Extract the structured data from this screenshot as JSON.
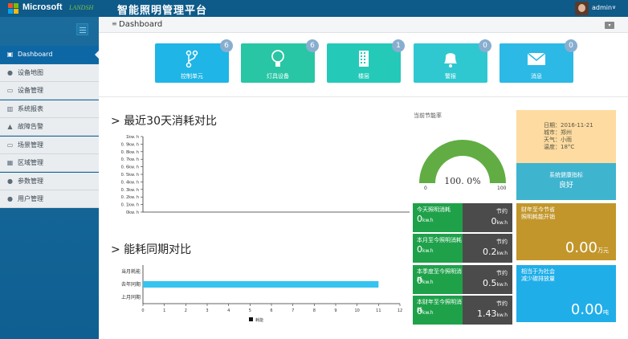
{
  "brand": {
    "name": "Microsoft",
    "secondary": "LANDSH"
  },
  "app_title": "智能照明管理平台",
  "user": {
    "name": "admin",
    "caret": "∨"
  },
  "sidebar": {
    "items": [
      {
        "label": "Dashboard",
        "icon": "▣"
      },
      {
        "label": "设备地图",
        "icon": "●"
      },
      {
        "label": "设备管理",
        "icon": "▭"
      },
      {
        "label": "系统报表",
        "icon": "▥"
      },
      {
        "label": "故障告警",
        "icon": "▲"
      },
      {
        "label": "场景管理",
        "icon": "▭"
      },
      {
        "label": "区域管理",
        "icon": "▦"
      },
      {
        "label": "参数管理",
        "icon": "●"
      },
      {
        "label": "用户管理",
        "icon": "●"
      }
    ]
  },
  "breadcrumb": {
    "icon": "≡",
    "text": "Dashboard"
  },
  "tiles": [
    {
      "label": "控制单元",
      "badge": "6",
      "color": "#1fb5e6",
      "icon": "branch"
    },
    {
      "label": "灯具设备",
      "badge": "6",
      "color": "#28c6a4",
      "icon": "bulb"
    },
    {
      "label": "楼层",
      "badge": "1",
      "color": "#25c9b8",
      "icon": "building"
    },
    {
      "label": "警报",
      "badge": "0",
      "color": "#2fc8d1",
      "icon": "bell"
    },
    {
      "label": "消息",
      "badge": "0",
      "color": "#2cb9e5",
      "icon": "mail"
    }
  ],
  "energy_section": {
    "title": "> 最近30天消耗对比"
  },
  "period_section": {
    "title": "> 能耗同期对比"
  },
  "saving_rate": {
    "title": "当前节能率",
    "min_label": "0",
    "max_label": "100",
    "value_label": "100. 0%"
  },
  "chart_data": [
    {
      "type": "line",
      "title": "最近30天消耗对比",
      "y_ticks": [
        "1kw. h",
        "0. 9kw. h",
        "0. 8kw. h",
        "0. 7kw. h",
        "0. 6kw. h",
        "0. 5kw. h",
        "0. 4kw. h",
        "0. 3kw. h",
        "0. 2kw. h",
        "0. 1kw. h",
        "0kw. h"
      ],
      "ylim": [
        0,
        1
      ],
      "series": []
    },
    {
      "type": "bar",
      "title": "能耗同期对比",
      "orientation": "horizontal",
      "categories": [
        "当月耗能",
        "去年同期",
        "上月同期"
      ],
      "values": [
        0,
        11,
        0
      ],
      "x_ticks": [
        "0",
        "1",
        "2",
        "3",
        "4",
        "5",
        "6",
        "7",
        "8",
        "9",
        "10",
        "11",
        "12"
      ],
      "xlim": [
        0,
        12
      ],
      "legend": [
        "耗能"
      ],
      "bar_color": "#35c3ef"
    }
  ],
  "stats": [
    {
      "title": "今天照明消耗",
      "value": "0",
      "unit": "kw.h",
      "right_label": "节约",
      "right_value": "0",
      "right_unit": "kw.h"
    },
    {
      "title": "本月至今照明消耗",
      "value": "0",
      "unit": "kw.h",
      "right_label": "节约",
      "right_value": "0.2",
      "right_unit": "kw.h"
    },
    {
      "title": "本季度至今照明消耗",
      "value": "0",
      "unit": "kw.h",
      "right_label": "节约",
      "right_value": "0.5",
      "right_unit": "kw.h"
    },
    {
      "title": "本财年至今照明消耗",
      "value": "0",
      "unit": "kw.h",
      "right_label": "节约",
      "right_value": "1.43",
      "right_unit": "kw.h"
    }
  ],
  "weather": {
    "date": "日期：2016-11-21",
    "city": "城市：郑州",
    "weather": "天气：小雨",
    "temp": "温度：18°C"
  },
  "health": {
    "title": "系统健康指标",
    "value": "良好"
  },
  "savings_cost": {
    "line1": "财年至今节省",
    "line2": "照明耗能开销",
    "value": "0.00",
    "unit": "万元"
  },
  "social": {
    "line1": "相当于为社会",
    "line2": "减少碳排放量",
    "value": "0.00",
    "unit": "吨"
  }
}
